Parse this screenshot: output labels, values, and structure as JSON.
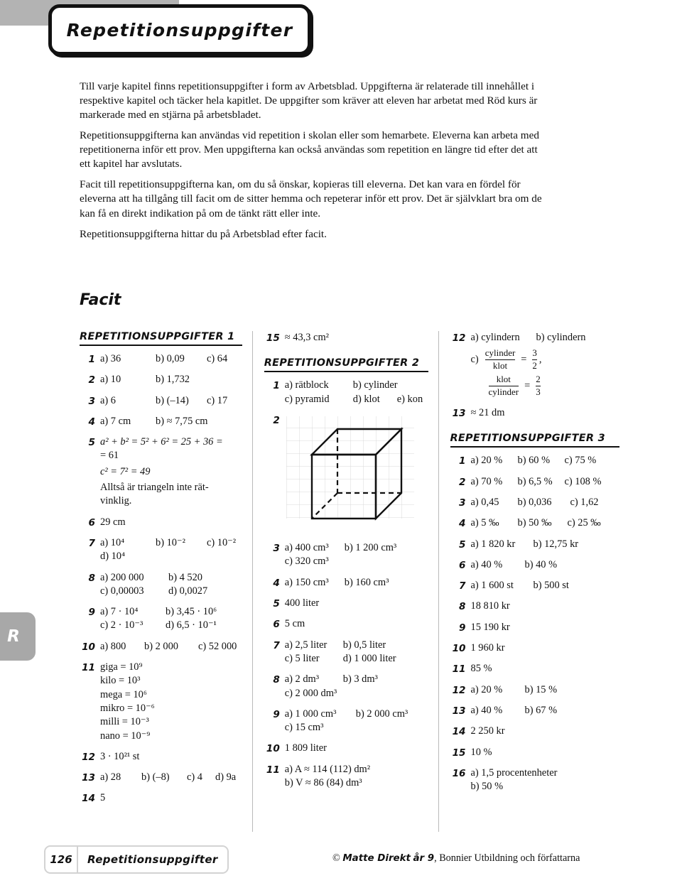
{
  "page": {
    "title": "Repetitionsuppgifter",
    "side_tab": "R",
    "facit_heading": "Facit",
    "page_number": "126",
    "footer_name": "Repetitionsuppgifter",
    "copyright_prefix": "©",
    "copyright_brand": "Matte Direkt",
    "copyright_brand2": "år 9",
    "copyright_rest": ", Bonnier Utbildning och författarna"
  },
  "intro": {
    "paragraphs": [
      "Till varje kapitel finns repetitionsuppgifter i form av Arbetsblad. Uppgifterna är relaterade till innehållet i respektive kapitel och täcker hela kapitlet. De uppgifter som kräver att eleven har arbetat med Röd kurs är markerade med en stjärna på arbetsbladet.",
      "Repetitionsuppgifterna kan användas vid repetition i skolan eller som hemarbete. Eleverna kan arbeta med repetitionerna inför ett prov. Men uppgifterna kan också användas som repetition en längre tid efter det att ett kapitel har avslutats.",
      "Facit till repetitionsuppgifterna kan, om du så önskar, kopieras till eleverna. Det kan vara en fördel för eleverna att ha tillgång till facit om de sitter hemma och repeterar inför ett prov. Det är självklart bra om de kan få en direkt indikation på om de tänkt rätt eller inte.",
      "Repetitionsuppgifterna hittar du på Arbetsblad efter facit."
    ]
  },
  "sections": {
    "rep1_heading": "REPETITIONSUPPGIFTER 1",
    "rep2_heading": "REPETITIONSUPPGIFTER 2",
    "rep3_heading": "REPETITIONSUPPGIFTER 3"
  },
  "rep1": [
    {
      "n": "1",
      "l1a": "a) 36",
      "l1b": "b) 0,09",
      "l1c": "c) 64"
    },
    {
      "n": "2",
      "l1a": "a) 10",
      "l1b": "b) 1,732"
    },
    {
      "n": "3",
      "l1a": "a) 6",
      "l1b": "b) (–14)",
      "l1c": "c) 17"
    },
    {
      "n": "4",
      "l1a": "a) 7 cm",
      "l1b": "b) ≈ 7,75 cm"
    },
    {
      "n": "5",
      "line1": "a² + b² = 5² + 6² = 25 + 36 =",
      "line2": "= 61",
      "line3": "c² = 7² = 49",
      "line4": "Alltså är triangeln inte rät-",
      "line5": "vinklig."
    },
    {
      "n": "6",
      "l1a": "29 cm"
    },
    {
      "n": "7",
      "l1a": "a) 10⁴",
      "l1b": "b) 10⁻²",
      "l1c": "c) 10⁻²",
      "l2a": "d) 10⁴"
    },
    {
      "n": "8",
      "l1a": "a) 200 000",
      "l1b": "b) 4 520",
      "l2a": "c) 0,00003",
      "l2b": "d) 0,0027"
    },
    {
      "n": "9",
      "l1a": "a) 7 · 10⁴",
      "l1b": "b) 3,45 · 10⁶",
      "l2a": "c) 2 · 10⁻³",
      "l2b": "d) 6,5 · 10⁻¹"
    },
    {
      "n": "10",
      "l1a": "a) 800",
      "l1b": "b) 2 000",
      "l1c": "c) 52 000"
    },
    {
      "n": "11",
      "lines": [
        "giga = 10⁹",
        "kilo = 10³",
        "mega = 10⁶",
        "mikro = 10⁻⁶",
        "milli = 10⁻³",
        "nano = 10⁻⁹"
      ]
    },
    {
      "n": "12",
      "l1a": "3 · 10²¹ st"
    },
    {
      "n": "13",
      "l1a": "a) 28",
      "l1b": "b) (–8)",
      "l1c": "c) 4",
      "l1d": "d) 9a"
    },
    {
      "n": "14",
      "l1a": "5"
    }
  ],
  "rep1_tail": {
    "n": "15",
    "text": "≈ 43,3 cm²"
  },
  "rep2": [
    {
      "n": "1",
      "l1a": "a) rätblock",
      "l1b": "b) cylinder",
      "l2a": "c) pyramid",
      "l2b": "d) klot",
      "l2c": "e) kon"
    },
    {
      "n": "2",
      "figure": "cube-on-grid"
    },
    {
      "n": "3",
      "l1a": "a) 400 cm³",
      "l1b": "b) 1 200 cm³",
      "l2a": "c) 320 cm³"
    },
    {
      "n": "4",
      "l1a": "a) 150 cm³",
      "l1b": "b) 160 cm³"
    },
    {
      "n": "5",
      "l1a": "400 liter"
    },
    {
      "n": "6",
      "l1a": "5 cm"
    },
    {
      "n": "7",
      "l1a": "a) 2,5 liter",
      "l1b": "b) 0,5 liter",
      "l2a": "c) 5 liter",
      "l2b": "d) 1 000 liter"
    },
    {
      "n": "8",
      "l1a": "a) 2 dm³",
      "l1b": "b) 3 dm³",
      "l2a": "c) 2 000 dm³"
    },
    {
      "n": "9",
      "l1a": "a) 1 000 cm³",
      "l1b": "b) 2 000 cm³",
      "l2a": "c) 15 cm³"
    },
    {
      "n": "10",
      "l1a": "1 809 liter"
    },
    {
      "n": "11",
      "l1a": "a) A ≈ 114 (112) dm²",
      "l2a": "b) V ≈ 86 (84) dm³"
    }
  ],
  "rep2_tail": [
    {
      "n": "12",
      "l1a": "a) cylindern",
      "l1b": "b) cylindern",
      "frac_label": "c)",
      "frac1_num": "cylinder",
      "frac1_den": "klot",
      "frac1_eq": "=",
      "frac1_rnum": "3",
      "frac1_rden": "2",
      "frac1_comma": ",",
      "frac2_num": "klot",
      "frac2_den": "cylinder",
      "frac2_eq": "=",
      "frac2_rnum": "2",
      "frac2_rden": "3"
    },
    {
      "n": "13",
      "l1a": "≈ 21 dm"
    }
  ],
  "rep3": [
    {
      "n": "1",
      "l1a": "a) 20 %",
      "l1b": "b) 60 %",
      "l1c": "c) 75 %"
    },
    {
      "n": "2",
      "l1a": "a) 70 %",
      "l1b": "b) 6,5 %",
      "l1c": "c) 108 %"
    },
    {
      "n": "3",
      "l1a": "a) 0,45",
      "l1b": "b) 0,036",
      "l1c": "c) 1,62"
    },
    {
      "n": "4",
      "l1a": "a) 5 ‰",
      "l1b": "b) 50 ‰",
      "l1c": "c) 25 ‰"
    },
    {
      "n": "5",
      "l1a": "a) 1 820 kr",
      "l1b": "b) 12,75 kr"
    },
    {
      "n": "6",
      "l1a": "a) 40 %",
      "l1b": "b) 40 %"
    },
    {
      "n": "7",
      "l1a": "a) 1 600 st",
      "l1b": "b) 500 st"
    },
    {
      "n": "8",
      "l1a": "18 810 kr"
    },
    {
      "n": "9",
      "l1a": "15 190 kr"
    },
    {
      "n": "10",
      "l1a": "1 960 kr"
    },
    {
      "n": "11",
      "l1a": "85 %"
    },
    {
      "n": "12",
      "l1a": "a) 20 %",
      "l1b": "b) 15 %"
    },
    {
      "n": "13",
      "l1a": "a) 40 %",
      "l1b": "b) 67 %"
    },
    {
      "n": "14",
      "l1a": "2 250 kr"
    },
    {
      "n": "15",
      "l1a": "10 %"
    },
    {
      "n": "16",
      "l1a": "a) 1,5 procentenheter",
      "l2a": "b) 50 %"
    }
  ],
  "colors": {
    "band": "#b3b3b3",
    "tab": "#a8a8a8",
    "grid": "#d9d9d9",
    "rule": "#111111"
  }
}
